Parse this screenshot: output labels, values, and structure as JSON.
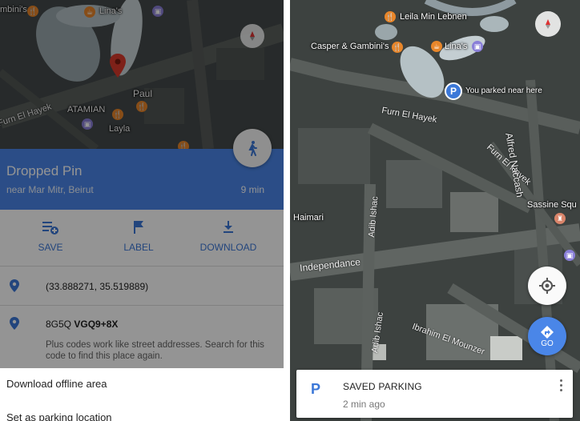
{
  "left_map": {
    "labels": {
      "top_poi": "Lina's",
      "paul": "Paul",
      "atamian": "ATAMIAN",
      "layla": "Layla",
      "street": "Furn El Hayek",
      "partial_top": "mbini's"
    }
  },
  "place": {
    "title": "Dropped Pin",
    "subtitle": "near Mar Mitr, Beirut",
    "eta": "9 min"
  },
  "actions": [
    {
      "label": "SAVE",
      "icon": "save-list-icon"
    },
    {
      "label": "LABEL",
      "icon": "flag-icon"
    },
    {
      "label": "DOWNLOAD",
      "icon": "download-icon"
    }
  ],
  "details": {
    "coordinates": "(33.888271, 35.519889)",
    "plus_code_prefix": "8G5Q ",
    "plus_code_bold": "VGQ9+8X",
    "plus_code_desc": "Plus codes work like street addresses. Search for this code to find this place again."
  },
  "sheet": {
    "items": [
      "Download offline area",
      "Set as parking location"
    ]
  },
  "right_map": {
    "labels": {
      "leila": "Leila Min Lebnen",
      "casper": "Casper & Gambini's",
      "linas": "Lina's",
      "parked": "You parked near here",
      "furn1": "Furn El Hayek",
      "furn2": "Furn El Hayek",
      "alfred": "Alfred Naccash",
      "sassine": "Sassine Squ",
      "haimari": "Haimari",
      "adib1": "Adib Ishac",
      "adib2": "Adib Ishac",
      "independance": "Independance",
      "ibrahim": "Ibrahim El Mounzer"
    },
    "go_label": "GO"
  },
  "parking": {
    "badge": "P",
    "title": "SAVED PARKING",
    "time": "2 min ago"
  },
  "colors": {
    "accent": "#4a86e8",
    "action_blue": "#3c78d8",
    "poi_orange": "#e8862a",
    "poi_purple": "#8a7fd8"
  }
}
